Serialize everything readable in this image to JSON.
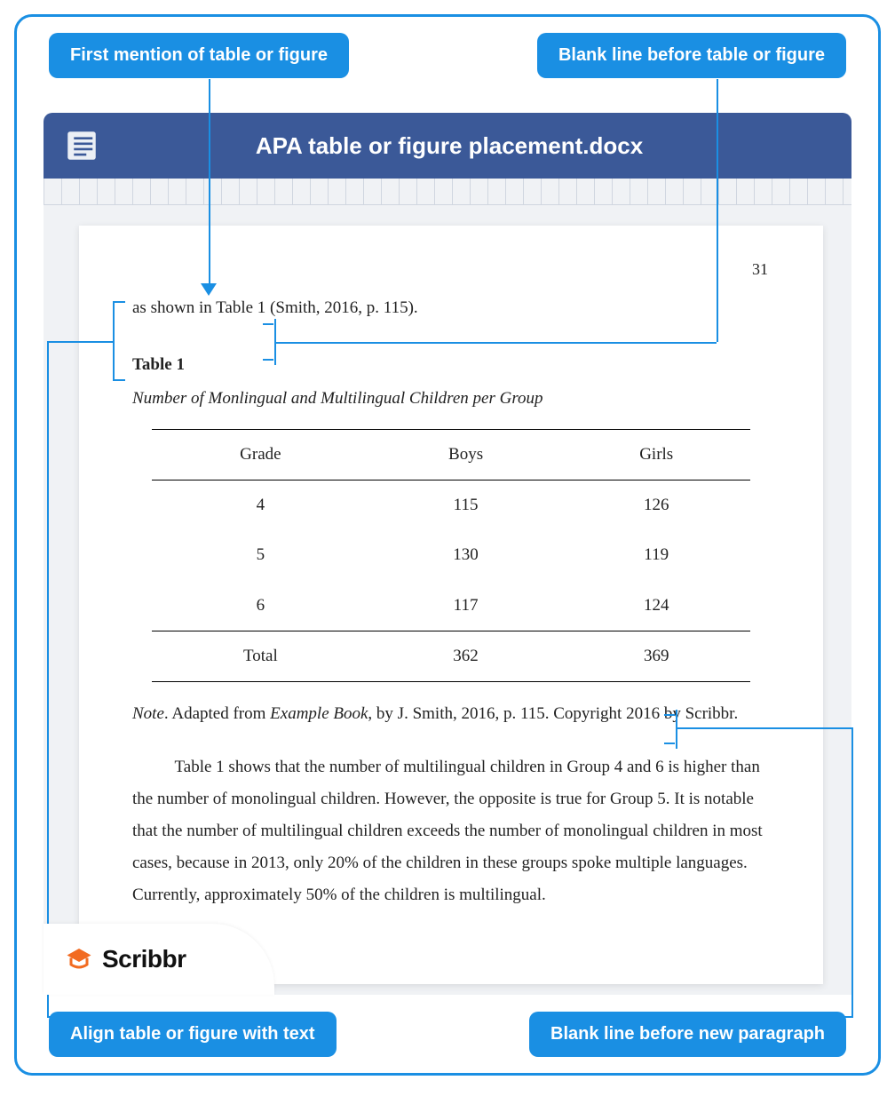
{
  "callouts": {
    "top_left": "First mention of table or figure",
    "top_right": "Blank line before table or figure",
    "bottom_left": "Align table or figure with text",
    "bottom_right": "Blank line before new paragraph"
  },
  "titlebar": {
    "filename": "APA table or figure placement.docx"
  },
  "page": {
    "number": "31",
    "intro_line": "as shown in Table 1 (Smith, 2016, p. 115).",
    "table_label": "Table 1",
    "table_title": "Number of Monlingual and Multilingual Children per Group",
    "table": {
      "headers": [
        "Grade",
        "Boys",
        "Girls"
      ],
      "rows": [
        [
          "4",
          "115",
          "126"
        ],
        [
          "5",
          "130",
          "119"
        ],
        [
          "6",
          "117",
          "124"
        ]
      ],
      "total_row": [
        "Total",
        "362",
        "369"
      ]
    },
    "note": {
      "label": "Note",
      "before_book": ". Adapted from ",
      "book_title": "Example Book",
      "after_book": ", by J. Smith, 2016, p. 115. Copyright 2016 by Scribbr."
    },
    "body_paragraph": "Table 1 shows that the number of multilingual children in Group 4 and 6 is higher than the number of monolingual children. However, the opposite is true for Group 5. It is notable that the number of multilingual children exceeds the number of monolingual children in most cases, because in 2013, only 20% of the children in these groups spoke multiple languages. Currently, approximately 50% of the children is multilingual."
  },
  "logo": {
    "brand": "Scribbr"
  },
  "chart_data": {
    "type": "table",
    "title": "Number of Monlingual and Multilingual Children per Group",
    "columns": [
      "Grade",
      "Boys",
      "Girls"
    ],
    "rows": [
      {
        "Grade": "4",
        "Boys": 115,
        "Girls": 126
      },
      {
        "Grade": "5",
        "Boys": 130,
        "Girls": 119
      },
      {
        "Grade": "6",
        "Boys": 117,
        "Girls": 124
      },
      {
        "Grade": "Total",
        "Boys": 362,
        "Girls": 369
      }
    ]
  }
}
